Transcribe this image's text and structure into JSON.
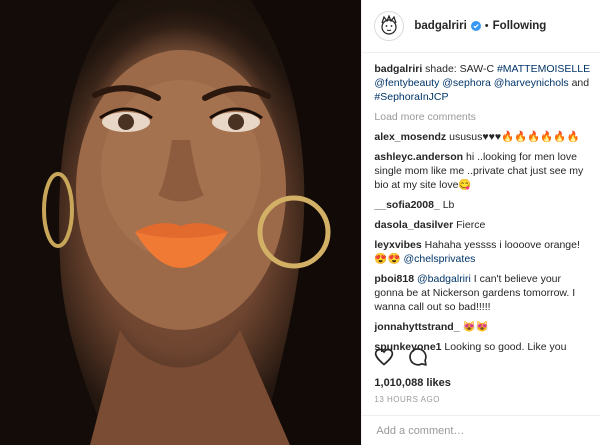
{
  "header": {
    "username": "badgalriri",
    "separator": "•",
    "follow_label": "Following"
  },
  "caption": {
    "username": "badgalriri",
    "text": "shade: SAW-C ",
    "links": [
      "#MATTEMOISELLE",
      "@fentybeauty",
      "@sephora",
      "@harveynichols"
    ],
    "and": "and",
    "last_link": "#SephoraInJCP"
  },
  "load_more": "Load more comments",
  "comments": [
    {
      "user": "alex_mosendz",
      "text": "ususus♥♥♥🔥🔥🔥🔥🔥🔥"
    },
    {
      "user": "ashleyc.anderson",
      "text": "hi ..looking for men love single mom like me ..private chat just see my bio at my site love😋"
    },
    {
      "user": "__sofia2008_",
      "text": "Lb"
    },
    {
      "user": "dasola_dasilver",
      "text": "Fierce"
    },
    {
      "user": "leyxvibes",
      "text": "Hahaha yessss i loooove orange! 😍😍",
      "link": "@chelsprivates"
    },
    {
      "user": "pboi818",
      "link": "@badgalriri",
      "text": "I can't believe your gonna be at Nickerson gardens tomorrow. I wanna call out so bad!!!!!"
    },
    {
      "user": "jonnahyttstrand_",
      "text": "😻😻"
    },
    {
      "user": "spunkeyone1",
      "text": "Looking so good. Like you"
    }
  ],
  "likes": "1,010,088 likes",
  "time": "13 HOURS AGO",
  "add_comment_placeholder": "Add a comment…",
  "colors": {
    "link": "#003569",
    "verified": "#3897f0",
    "meta": "#999999"
  }
}
